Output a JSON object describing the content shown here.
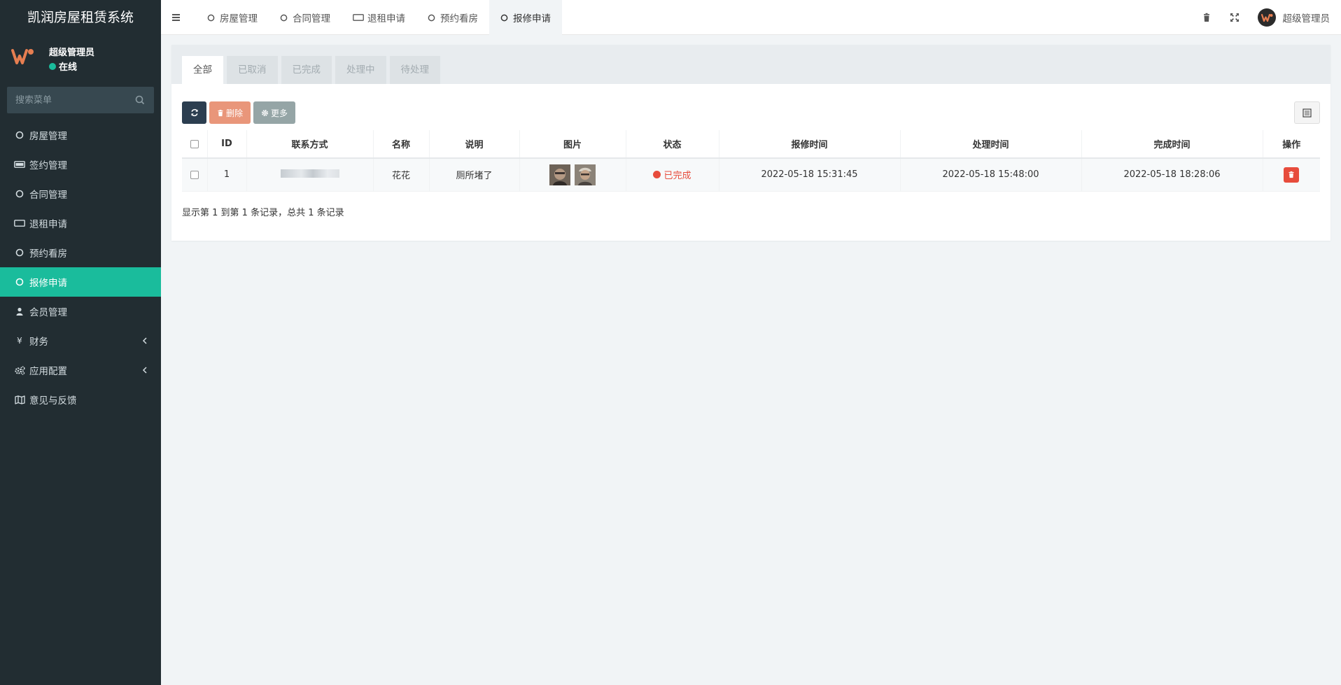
{
  "app": {
    "title": "凯润房屋租赁系统"
  },
  "user": {
    "name": "超级管理员",
    "status": "在线"
  },
  "search": {
    "placeholder": "搜索菜单"
  },
  "menu": [
    {
      "label": "房屋管理",
      "icon": "circle-icon"
    },
    {
      "label": "签约管理",
      "icon": "card-icon"
    },
    {
      "label": "合同管理",
      "icon": "circle-icon"
    },
    {
      "label": "退租申请",
      "icon": "rectangle-icon"
    },
    {
      "label": "预约看房",
      "icon": "circle-icon"
    },
    {
      "label": "报修申请",
      "icon": "circle-icon",
      "active": true
    },
    {
      "label": "会员管理",
      "icon": "user-icon"
    },
    {
      "label": "财务",
      "icon": "yen-icon",
      "has_children": true
    },
    {
      "label": "应用配置",
      "icon": "cogs-icon",
      "has_children": true
    },
    {
      "label": "意见与反馈",
      "icon": "map-icon"
    }
  ],
  "top_tabs": [
    {
      "label": "房屋管理",
      "icon": "circle-icon"
    },
    {
      "label": "合同管理",
      "icon": "circle-icon"
    },
    {
      "label": "退租申请",
      "icon": "rectangle-icon"
    },
    {
      "label": "预约看房",
      "icon": "circle-icon"
    },
    {
      "label": "报修申请",
      "icon": "circle-icon",
      "active": true
    }
  ],
  "topbar": {
    "admin_name": "超级管理员"
  },
  "sub_tabs": [
    "全部",
    "已取消",
    "已完成",
    "处理中",
    "待处理"
  ],
  "toolbar": {
    "delete_label": "删除",
    "more_label": "更多"
  },
  "table": {
    "headers": [
      "ID",
      "联系方式",
      "名称",
      "说明",
      "图片",
      "状态",
      "报修时间",
      "处理时间",
      "完成时间",
      "操作"
    ],
    "rows": [
      {
        "id": "1",
        "contact": "",
        "name": "花花",
        "description": "厕所堵了",
        "status": "已完成",
        "report_time": "2022-05-18 15:31:45",
        "process_time": "2022-05-18 15:48:00",
        "finish_time": "2022-05-18 18:28:06"
      }
    ]
  },
  "pager": {
    "info": "显示第 1 到第 1 条记录，总共 1 条记录"
  },
  "colors": {
    "sidebar": "#222d32",
    "accent": "#1abc9c",
    "danger": "#e74c3c",
    "dark_button": "#2c3e50"
  }
}
